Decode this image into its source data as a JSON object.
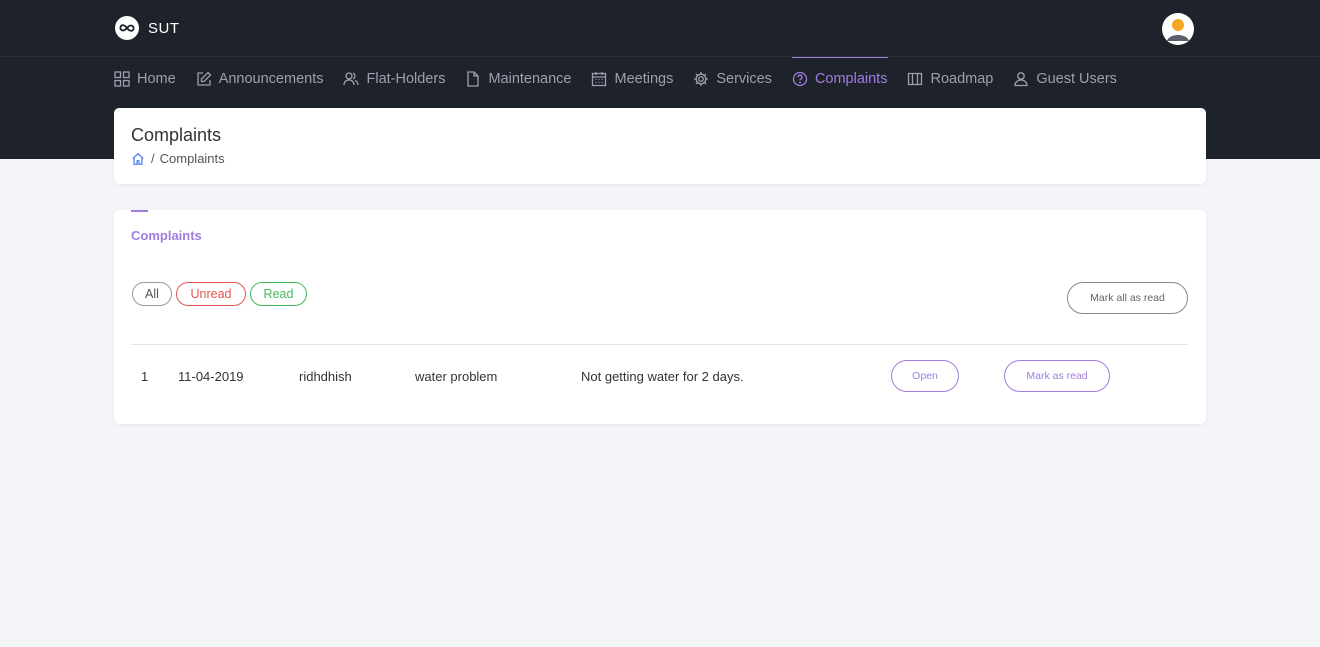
{
  "app": {
    "brand": "SUT"
  },
  "nav": {
    "items": [
      {
        "label": "Home",
        "icon": "grid-icon",
        "active": false
      },
      {
        "label": "Announcements",
        "icon": "edit-icon",
        "active": false
      },
      {
        "label": "Flat-Holders",
        "icon": "users-icon",
        "active": false
      },
      {
        "label": "Maintenance",
        "icon": "file-icon",
        "active": false
      },
      {
        "label": "Meetings",
        "icon": "calendar-icon",
        "active": false
      },
      {
        "label": "Services",
        "icon": "gear-icon",
        "active": false
      },
      {
        "label": "Complaints",
        "icon": "help-circle-icon",
        "active": true
      },
      {
        "label": "Roadmap",
        "icon": "map-icon",
        "active": false
      },
      {
        "label": "Guest Users",
        "icon": "user-icon",
        "active": false
      }
    ]
  },
  "header": {
    "title": "Complaints",
    "breadcrumb": {
      "separator": "/",
      "current": "Complaints"
    }
  },
  "main": {
    "section_title": "Complaints",
    "filters": {
      "all": "All",
      "unread": "Unread",
      "read": "Read"
    },
    "mark_all_label": "Mark all as read",
    "rows": [
      {
        "num": "1",
        "date": "11-04-2019",
        "user": "ridhdhish",
        "subject": "water problem",
        "description": "Not getting water for 2 days.",
        "open_label": "Open",
        "mark_label": "Mark as read"
      }
    ]
  },
  "colors": {
    "accent": "#a17dde",
    "dark_bg": "#1e222b",
    "unread": "#e55353",
    "read": "#43b95a"
  }
}
